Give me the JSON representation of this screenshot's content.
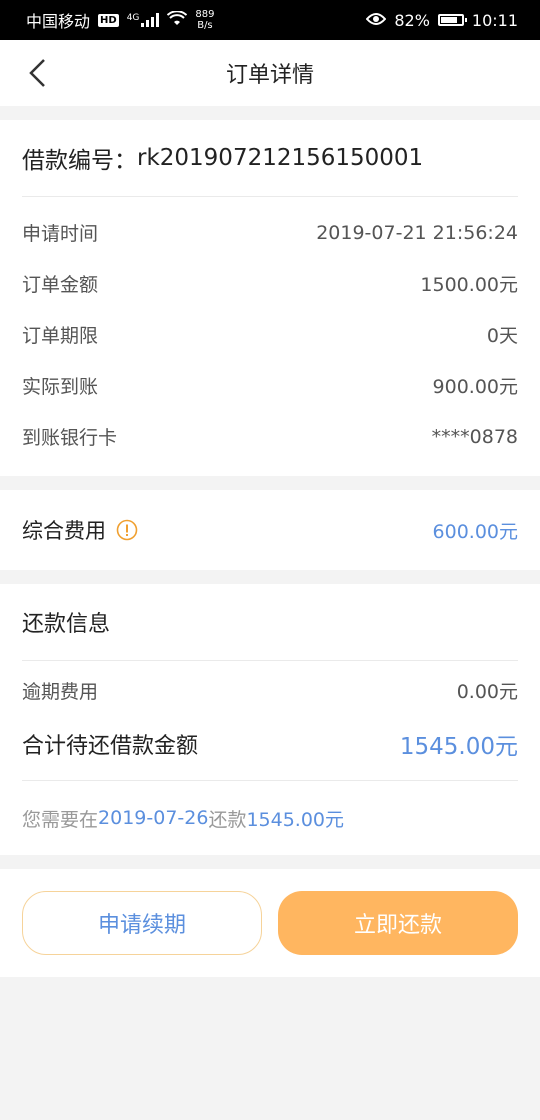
{
  "statusbar": {
    "carrier": "中国移动",
    "hd": "HD",
    "signal": "4G",
    "netspeed_value": "889",
    "netspeed_unit": "B/s",
    "battery": "82%",
    "battery_level": 0.82,
    "time": "10:11"
  },
  "navbar": {
    "title": "订单详情"
  },
  "loan": {
    "label": "借款编号：",
    "number": "rk201907212156150001"
  },
  "details": [
    {
      "key": "申请时间",
      "value": "2019-07-21 21:56:24"
    },
    {
      "key": "订单金额",
      "value": "1500.00元"
    },
    {
      "key": "订单期限",
      "value": "0天"
    },
    {
      "key": "实际到账",
      "value": "900.00元"
    },
    {
      "key": "到账银行卡",
      "value": "****0878"
    }
  ],
  "fee": {
    "label": "综合费用",
    "value": "600.00元"
  },
  "repay": {
    "title": "还款信息",
    "overdue_key": "逾期费用",
    "overdue_value": "0.00元",
    "total_key": "合计待还借款金额",
    "total_value": "1545.00元",
    "notice_prefix": "您需要在",
    "notice_date": "2019-07-26",
    "notice_mid": "还款",
    "notice_amount": "1545.00元"
  },
  "actions": {
    "renew_label": "申请续期",
    "repay_label": "立即还款"
  },
  "colors": {
    "accent_blue": "#5b8fde",
    "orange": "#ffb660",
    "warn_icon": "#f0a030"
  }
}
